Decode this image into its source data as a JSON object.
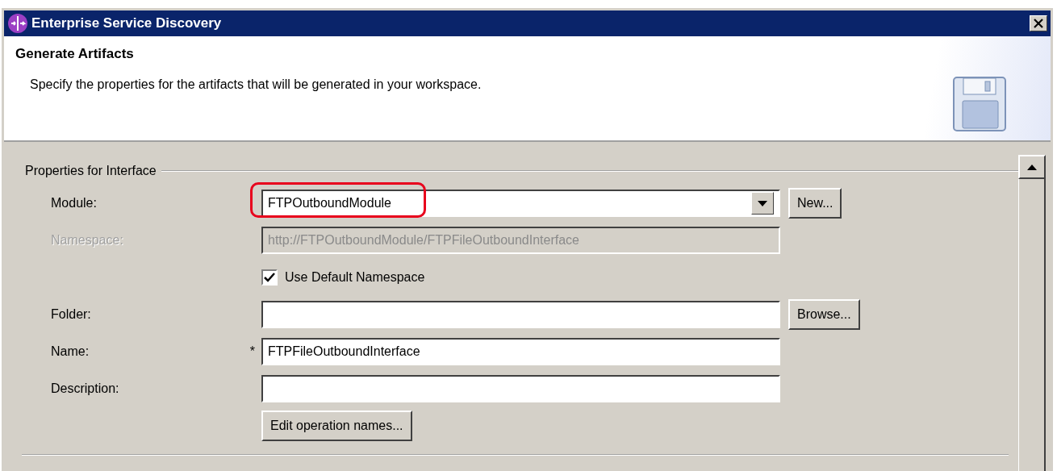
{
  "window": {
    "title": "Enterprise Service Discovery"
  },
  "header": {
    "title": "Generate Artifacts",
    "description": "Specify the properties for the artifacts that will be generated in your workspace."
  },
  "group": {
    "title": "Properties for Interface"
  },
  "rows": [
    {
      "kind": "combo",
      "label": "Module:",
      "value": "FTPOutboundModule",
      "disabled": false,
      "highlighted": true,
      "side_button": "New..."
    },
    {
      "kind": "text",
      "label": "Namespace:",
      "value": "http://FTPOutboundModule/FTPFileOutboundInterface",
      "disabled": true,
      "highlighted": false
    },
    {
      "kind": "checkbox",
      "label": "Use Default Namespace",
      "checked": true
    },
    {
      "kind": "text",
      "label": "Folder:",
      "value": "",
      "disabled": false,
      "highlighted": false,
      "side_button": "Browse..."
    },
    {
      "kind": "text",
      "label": "Name:",
      "value": "FTPFileOutboundInterface",
      "disabled": false,
      "required_mark": "*",
      "highlighted": false
    },
    {
      "kind": "text",
      "label": "Description:",
      "value": "",
      "disabled": false,
      "highlighted": false
    },
    {
      "kind": "button",
      "label": "Edit operation names..."
    }
  ]
}
